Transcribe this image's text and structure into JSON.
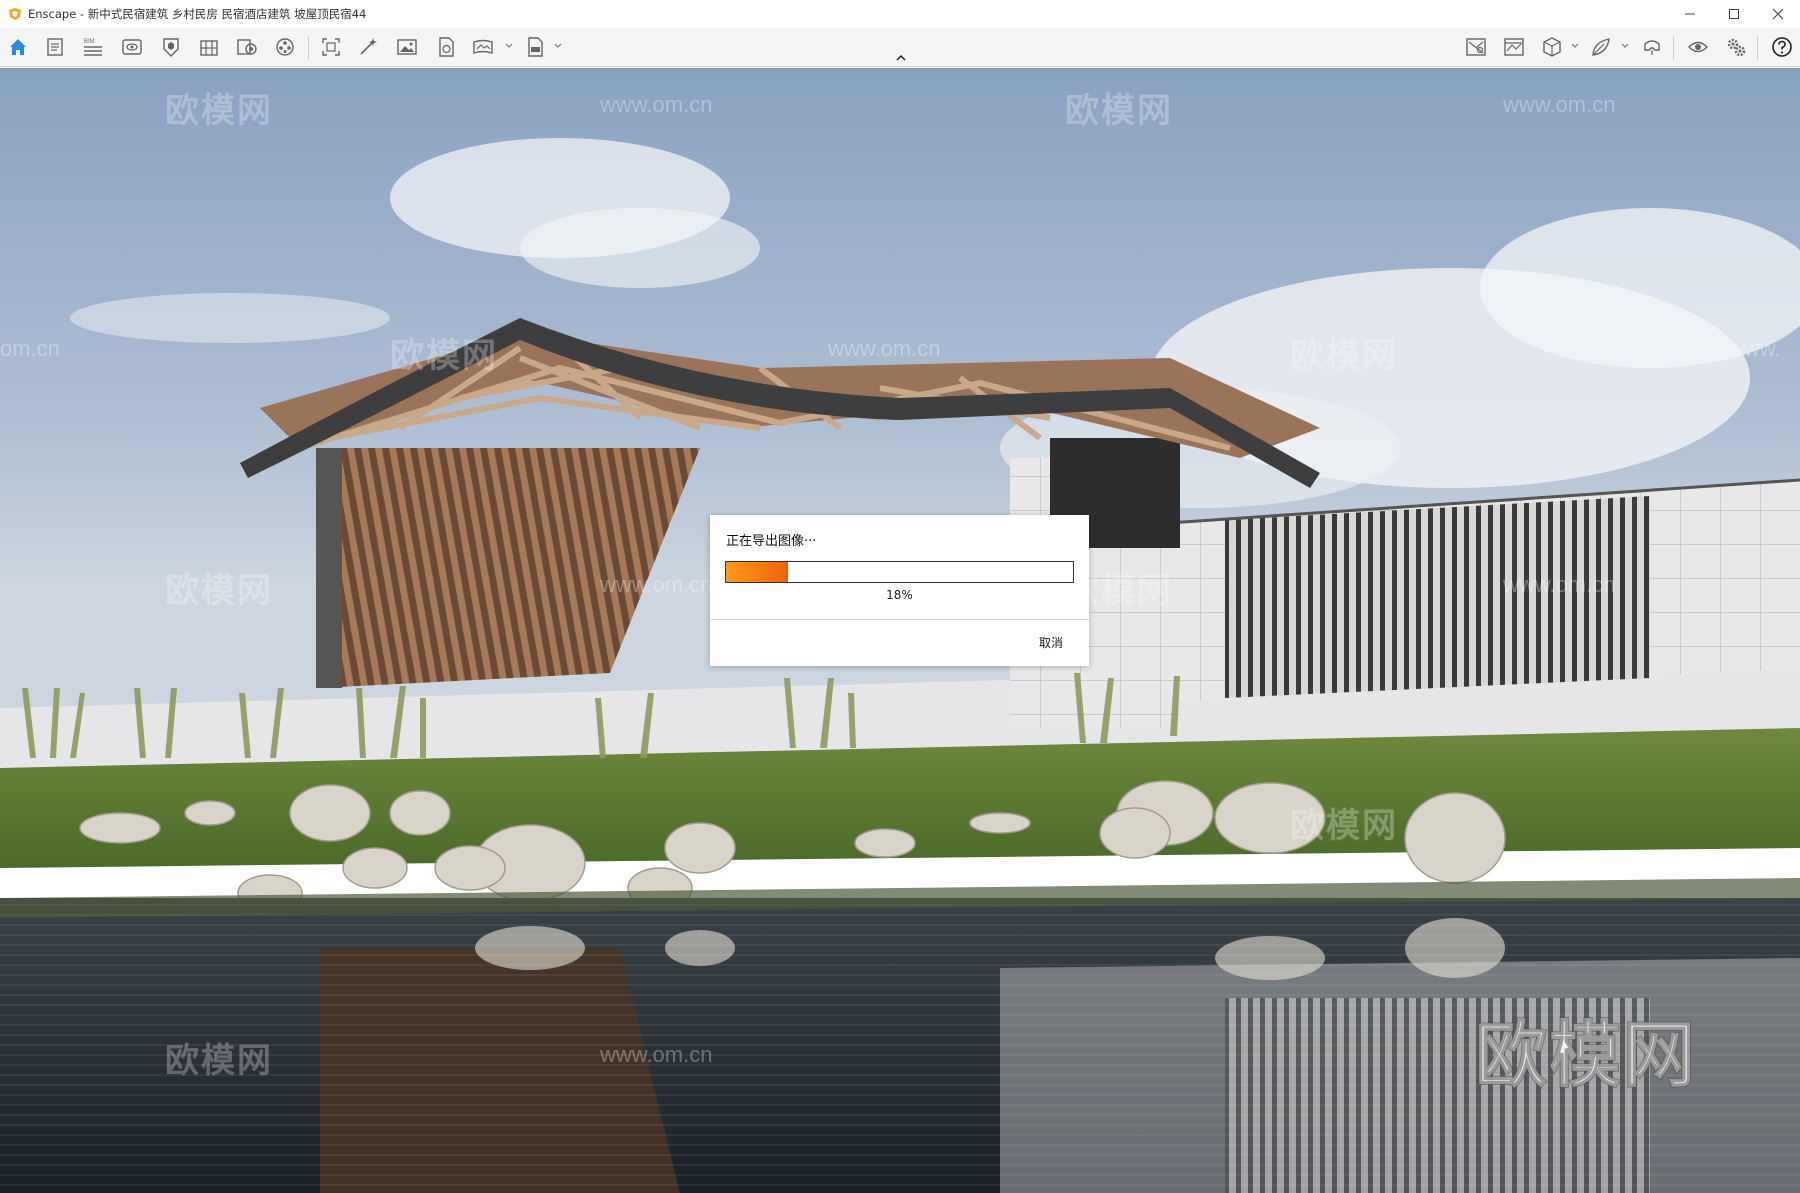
{
  "window": {
    "title": "Enscape - 新中式民宿建筑 乡村民房 民宿酒店建筑 坡屋顶民宿44",
    "controls": [
      "minimize",
      "maximize",
      "close"
    ]
  },
  "toolbar": {
    "left_icons": [
      "home-icon",
      "notes-icon",
      "bim-icon",
      "view-icon",
      "capture-icon",
      "building-icon",
      "asset-library-icon",
      "video-editor-icon",
      "batch-render-icon",
      "magic-icon",
      "image-icon",
      "export-file-icon",
      "panorama-icon",
      "exe-export-icon"
    ],
    "right_icons": [
      "map-icon",
      "visual-settings-icon",
      "section-cube-icon",
      "leaf-icon",
      "vr-headset-icon",
      "eye-icon",
      "settings-icon",
      "help-icon"
    ],
    "bim_label": "BIM"
  },
  "watermarks": {
    "logo": "欧模网",
    "url": "www.om.cn",
    "url_partial_left": "om.cn",
    "url_partial_right": "www."
  },
  "dialog": {
    "title": "正在导出图像···",
    "progress_percent": 18,
    "progress_text": "18%",
    "cancel_label": "取消"
  },
  "colors": {
    "accent": "#f08a1c",
    "home_icon": "#2a8ae8",
    "sky_top": "#8da5c4",
    "water": "#1d242c"
  }
}
